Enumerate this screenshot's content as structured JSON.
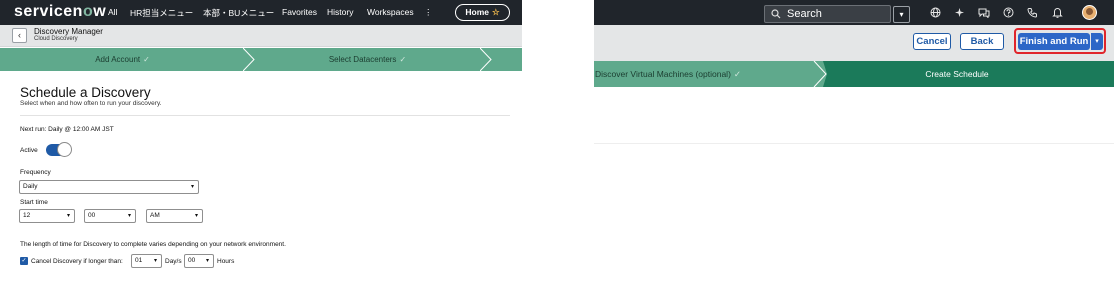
{
  "left": {
    "logo": "servicenow",
    "nav": [
      "All",
      "HR担当メニュー",
      "本部・BUメニュー",
      "Favorites",
      "History",
      "Workspaces",
      "⋮"
    ],
    "home_label": "Home",
    "home_star": "☆",
    "header": {
      "title": "Discovery Manager",
      "subtitle": "Cloud Discovery",
      "back_icon": "‹"
    },
    "steps": [
      {
        "label": "Add Account",
        "check": "✓"
      },
      {
        "label": "Select Datacenters",
        "check": "✓"
      }
    ],
    "page_title": "Schedule a Discovery",
    "page_subtitle": "Select when and how often to run your discovery.",
    "next_run": "Next run: Daily @ 12:00 AM JST",
    "active_label": "Active",
    "active_on": true,
    "frequency_label": "Frequency",
    "frequency_value": "Daily",
    "start_time_label": "Start time",
    "start_hour": "12",
    "start_minute": "00",
    "start_ampm": "AM",
    "note": "The length of time for Discovery to complete varies depending on your network environment.",
    "cancel_checked": true,
    "cancel_label": "Cancel Discovery if longer than:",
    "days_value": "01",
    "days_label": "Day/s",
    "hours_value": "00",
    "hours_label": "Hours",
    "caret": "▾"
  },
  "right": {
    "search_placeholder": "Search",
    "search_icon": "search-icon",
    "cancel_label": "Cancel",
    "back_label": "Back",
    "finish_label": "Finish and Run",
    "steps": [
      {
        "label": "Discover Virtual Machines (optional)",
        "check": "✓"
      },
      {
        "label": "Create Schedule"
      }
    ],
    "caret": "▾"
  },
  "colors": {
    "nav_bg": "#20252b",
    "stepper": "#5fa98c",
    "active_step": "#1b7a5a",
    "accent": "#1f5aa6",
    "primary": "#2c66c7",
    "highlight": "#e0252b"
  }
}
